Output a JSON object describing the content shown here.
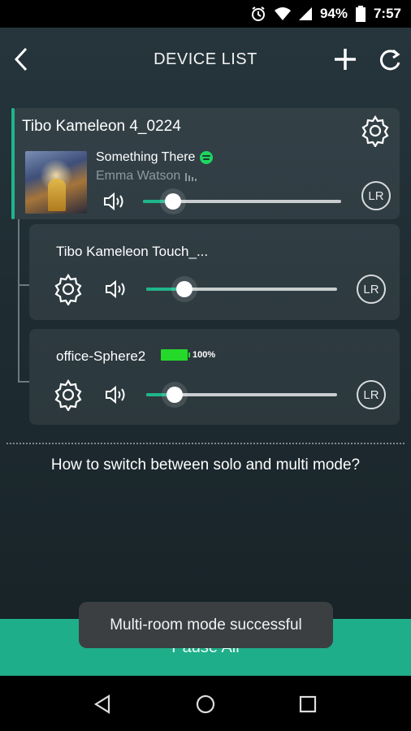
{
  "status_bar": {
    "battery": "94%",
    "time": "7:57",
    "icons": [
      "alarm-icon",
      "wifi-icon",
      "signal-icon",
      "battery-icon"
    ]
  },
  "header": {
    "title": "DEVICE LIST",
    "icons": [
      "back-icon",
      "add-icon",
      "refresh-icon"
    ]
  },
  "master": {
    "name": "Tibo Kameleon 4_0224",
    "track": "Something There",
    "artist": "Emma Watson",
    "volume": 0.15,
    "channel": "LR",
    "source_icon": "spotify-icon"
  },
  "slaves": [
    {
      "name": "Tibo Kameleon Touch_...",
      "volume": 0.2,
      "channel": "LR",
      "battery": ""
    },
    {
      "name": "office-Sphere2",
      "volume": 0.15,
      "channel": "LR",
      "battery": "100%"
    }
  ],
  "help_text": "How to switch between solo and multi mode?",
  "pause_all": "Pause All",
  "toast": "Multi-room mode successful",
  "colors": {
    "accent": "#1fb58b",
    "battery": "#25d92a"
  }
}
